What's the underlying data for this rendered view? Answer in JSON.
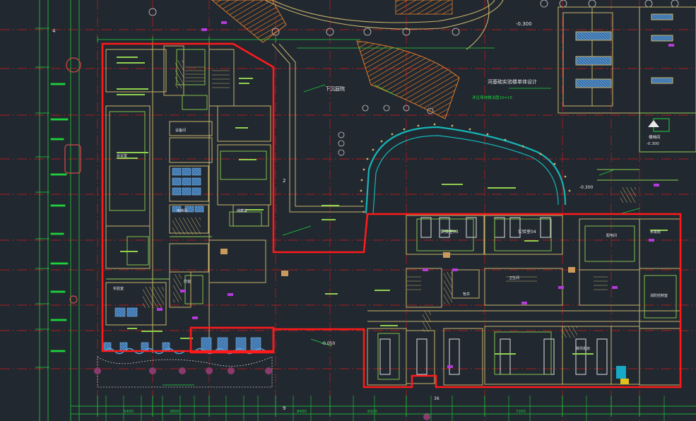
{
  "drawing": {
    "background_color": "#212830",
    "boundary_color": "#ff1a1a",
    "axis_color": "#c21b1b",
    "wall_color": "#c9b36a",
    "room_line_color": "#8fd14f",
    "ramp_color": "#e07c2a",
    "dim_color": "#1fd33b",
    "curve_color": "#15b6b6",
    "marker_color": "#b43ad9"
  },
  "labels": {
    "elev_top": "-0.300",
    "elev_right": "-0.300",
    "ramp_zone": "下沉庭院",
    "ramp_text": "河基础实验楼单体设计",
    "ramp_note": "详见场地做法图15=15",
    "elev_mid": "-0.300",
    "stair_tag": "楼梯间",
    "right_elev": "-0.300",
    "room_a": "设备间",
    "room_b": "会议室",
    "room_c": "储藏室",
    "room_d": "实验室",
    "room_e": "电梯间",
    "room_f": "前室",
    "room_g": "配电间",
    "room_h": "水泵房",
    "room_i": "排风机房",
    "room_j": "消防控制室",
    "room_k": "卫生间",
    "room_l": "管井",
    "lab_01": "实验室03",
    "lab_02": "实验室04",
    "elev_bottom": "-0.050",
    "axis_4": "4",
    "axis_2": "2",
    "axis_9": "9",
    "axis_36": "36",
    "dim_1": "5400",
    "dim_2": "3600",
    "dim_3": "8400",
    "dim_4": "8100",
    "dim_5": "7200"
  }
}
